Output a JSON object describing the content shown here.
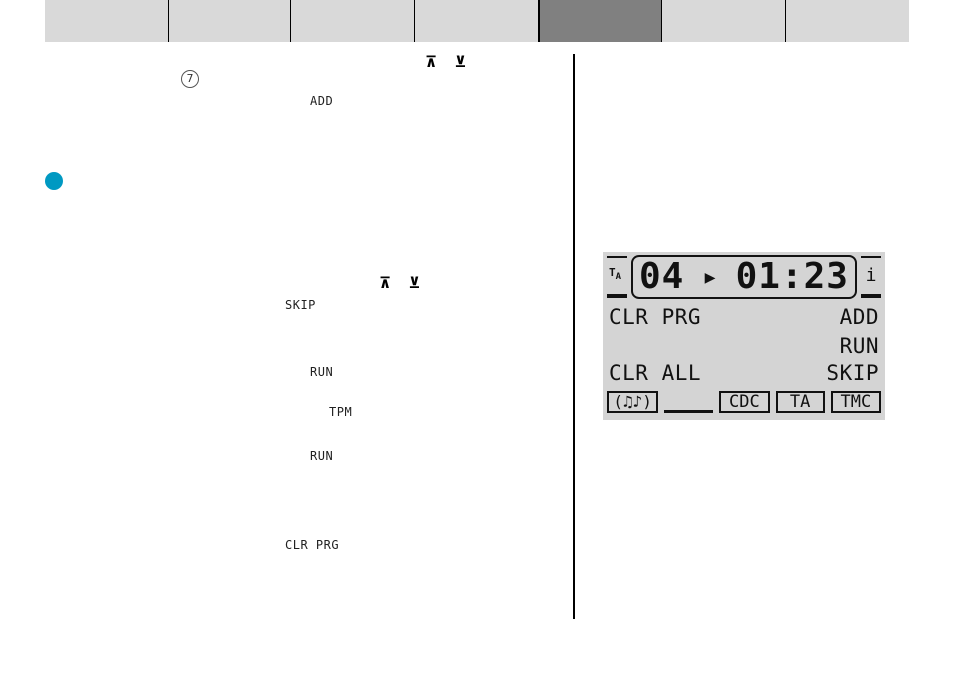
{
  "tabs": [
    {
      "label": "",
      "active": false
    },
    {
      "label": "",
      "active": false
    },
    {
      "label": "",
      "active": false
    },
    {
      "label": "",
      "active": false
    },
    {
      "label": "",
      "active": true
    },
    {
      "label": "",
      "active": false
    },
    {
      "label": "",
      "active": false
    }
  ],
  "colors": {
    "tab_bg": "#d9d9d9",
    "tab_active_bg": "#808080",
    "bullet": "#0099c2",
    "lcd_bg": "#d4d4d4"
  },
  "text_column": {
    "arrows_1": "⊼ ⊻",
    "circled_number": "7",
    "keyword_add": "ADD",
    "arrows_2": "⊼ ⊻",
    "keyword_skip": "SKIP",
    "keyword_run_1": "RUN",
    "keyword_tpm": "TPM",
    "keyword_run_2": "RUN",
    "keyword_clr_prg": "CLR PRG"
  },
  "lcd": {
    "ta_indicator": "T",
    "ta_indicator_sub": "A",
    "track": "04",
    "play_symbol": "▶",
    "time": "01:23",
    "info_indicator": "i",
    "row1_left": "CLR PRG",
    "row1_right": "ADD",
    "row2_left": "",
    "row2_right": "RUN",
    "row3_left": "CLR ALL",
    "row3_right": "SKIP",
    "status_music": "(♫♪)",
    "status_cdc": "CDC",
    "status_ta": "TA",
    "status_tmc": "TMC"
  }
}
